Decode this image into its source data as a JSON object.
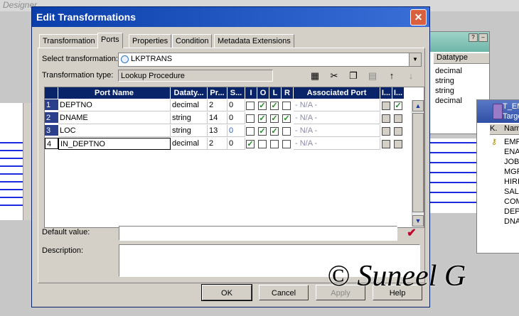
{
  "background": {
    "designer_label": "Designer",
    "source_panel": {
      "header": "Datatype",
      "rows": [
        "decimal",
        "string",
        "string",
        "decimal"
      ]
    },
    "target_panel": {
      "title1": "T_EM",
      "title2": "Targe",
      "header_k": "K.",
      "header_name": "Nam",
      "rows": [
        "EMP",
        "ENA",
        "JOB",
        "MGR",
        "HIRI",
        "SAL",
        "COM",
        "DEP",
        "DNA"
      ]
    }
  },
  "dialog": {
    "title": "Edit Transformations",
    "close_label": "✕",
    "tabs": [
      {
        "label": "Transformation"
      },
      {
        "label": "Ports"
      },
      {
        "label": "Properties"
      },
      {
        "label": "Condition"
      },
      {
        "label": "Metadata Extensions"
      }
    ],
    "select_label": "Select transformation:",
    "select_value": "LKPTRANS",
    "type_label": "Transformation type:",
    "type_value": "Lookup Procedure",
    "grid": {
      "columns": [
        "Port Name",
        "Dataty...",
        "Pr...",
        "S...",
        "I",
        "O",
        "L",
        "R",
        "Associated Port",
        "I...",
        "I..."
      ],
      "rows": [
        {
          "num": "1",
          "name": "DEPTNO",
          "type": "decimal",
          "prec": "2",
          "scale": "0",
          "I": false,
          "O": true,
          "L": true,
          "R": false,
          "assoc": "- N/A -",
          "x1": false,
          "x2": true
        },
        {
          "num": "2",
          "name": "DNAME",
          "type": "string",
          "prec": "14",
          "scale": "0",
          "I": false,
          "O": true,
          "L": true,
          "R": true,
          "assoc": "- N/A -",
          "x1": false,
          "x2": false
        },
        {
          "num": "3",
          "name": "LOC",
          "type": "string",
          "prec": "13",
          "scale": "0",
          "I": false,
          "O": true,
          "L": true,
          "R": false,
          "assoc": "- N/A -",
          "x1": false,
          "x2": false
        },
        {
          "num": "4",
          "name": "IN_DEPTNO",
          "type": "decimal",
          "prec": "2",
          "scale": "0",
          "I": true,
          "O": false,
          "L": false,
          "R": false,
          "assoc": "- N/A -",
          "x1": false,
          "x2": false
        }
      ]
    },
    "default_value_label": "Default value:",
    "description_label": "Description:",
    "buttons": {
      "ok": "OK",
      "cancel": "Cancel",
      "apply": "Apply",
      "help": "Help"
    }
  },
  "watermark": "© Suneel G"
}
